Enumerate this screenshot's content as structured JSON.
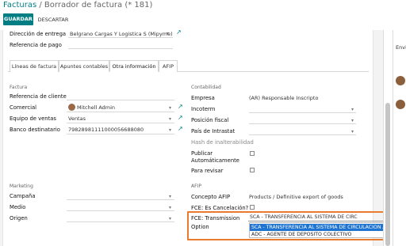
{
  "breadcrumb": {
    "parent": "Facturas",
    "separator": "/",
    "current": "Borrador de factura (* 181)"
  },
  "toolbar": {
    "save": "GUARDAR",
    "discard": "DESCARTAR"
  },
  "header_fields": {
    "delivery_label": "Dirección de entrega",
    "delivery_value": "Belgrano Cargas Y Logistica S (Mipyme)",
    "payment_ref_label": "Referencia de pago"
  },
  "tabs": [
    {
      "label": "Líneas de factura"
    },
    {
      "label": "Apuntes contables"
    },
    {
      "label": "Otra información"
    },
    {
      "label": "AFIP"
    }
  ],
  "left": {
    "section_invoice": "Factura",
    "customer_ref_label": "Referencia de cliente",
    "salesperson_label": "Comercial",
    "salesperson_value": "Mitchell Admin",
    "sales_team_label": "Equipo de ventas",
    "sales_team_value": "Ventas",
    "bank_label": "Banco destinatario",
    "bank_value": "79828981111000056688080",
    "section_marketing": "Marketing",
    "campaign_label": "Campaña",
    "medium_label": "Medio",
    "source_label": "Origen"
  },
  "right": {
    "section_accounting": "Contabilidad",
    "company_label": "Empresa",
    "company_value": "(AR) Responsable Inscripto",
    "incoterm_label": "Incoterm",
    "fiscal_label": "Posición fiscal",
    "intrastat_label": "País de Intrastat",
    "hash_label": "Hash de inalterabilidad",
    "publish_label_1": "Publicar",
    "publish_label_2": "Automáticamente",
    "review_label": "Para revisar",
    "section_afip": "AFIP",
    "concept_label": "Concepto AFIP",
    "concept_value": "Products / Definitive export of goods",
    "fce_cancel_label": "FCE: Es Cancelación?",
    "fce_transmission_label_1": "FCE: Transmission",
    "fce_transmission_label_2": "Option",
    "fce_current": "SCA - TRANSFERENCIA AL SISTEMA DE CIRC",
    "options": [
      "SCA - TRANSFERENCIA AL SISTEMA DE CIRCULACION ABIERTA",
      "ADC - AGENTE DE DEPOSITO COLECTIVO"
    ]
  },
  "chatter": {
    "send_label": "Envi"
  },
  "colors": {
    "accent": "#017e84",
    "highlight": "#ea7a2c",
    "selected": "#1e74d0"
  }
}
